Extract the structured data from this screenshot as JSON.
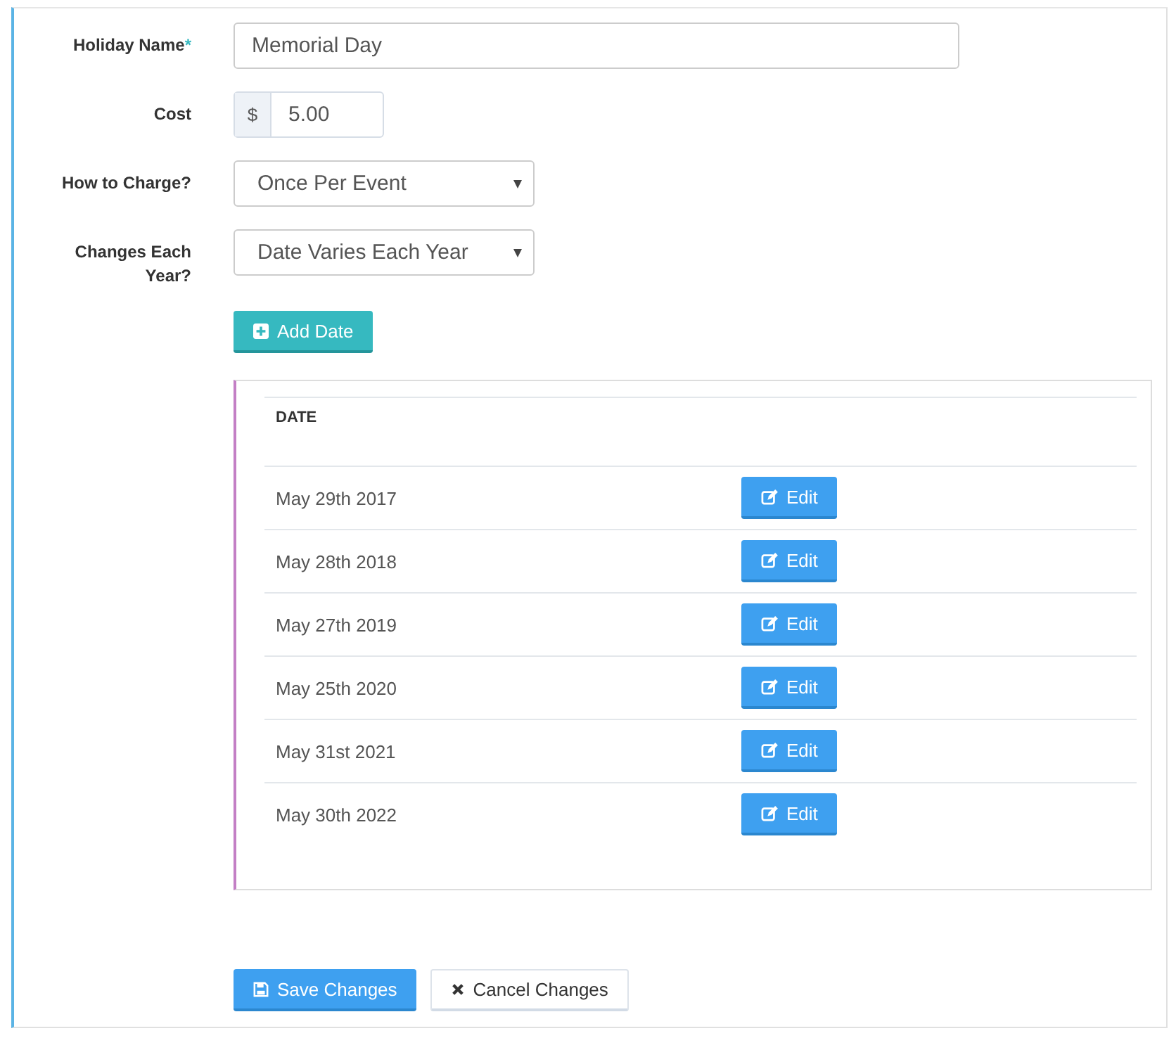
{
  "form": {
    "holiday_name": {
      "label": "Holiday Name",
      "required_mark": "*",
      "value": "Memorial Day"
    },
    "cost": {
      "label": "Cost",
      "prefix": "$",
      "value": "5.00"
    },
    "how_to_charge": {
      "label": "How to Charge?",
      "value": "Once Per Event"
    },
    "changes_each_year": {
      "label": "Changes Each Year?",
      "value": "Date Varies Each Year"
    },
    "add_button": "Add Date"
  },
  "dates_table": {
    "columns": [
      "DATE"
    ],
    "rows": [
      {
        "date": "May 29th 2017",
        "action": "Edit"
      },
      {
        "date": "May 28th 2018",
        "action": "Edit"
      },
      {
        "date": "May 27th 2019",
        "action": "Edit"
      },
      {
        "date": "May 25th 2020",
        "action": "Edit"
      },
      {
        "date": "May 31st 2021",
        "action": "Edit"
      },
      {
        "date": "May 30th 2022",
        "action": "Edit"
      }
    ]
  },
  "buttons": [
    {
      "kind": "primary",
      "label": "Save Changes"
    },
    {
      "kind": "default",
      "label": "Cancel Changes"
    }
  ]
}
